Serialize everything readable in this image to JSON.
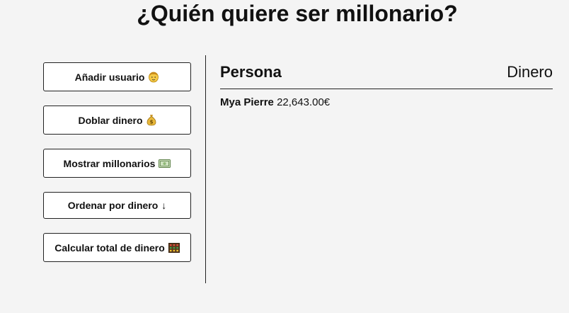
{
  "title": "¿Quién quiere ser millonario?",
  "buttons": {
    "add_user": {
      "label": "Añadir usuario",
      "icon": "person-face-icon"
    },
    "double_money": {
      "label": "Doblar dinero",
      "icon": "money-bag-icon"
    },
    "show_millionaires": {
      "label": "Mostrar millonarios",
      "icon": "banknote-icon"
    },
    "sort_money": {
      "label": "Ordenar por dinero",
      "arrow": "↓"
    },
    "total_money": {
      "label": "Calcular total de dinero",
      "icon": "abacus-icon"
    }
  },
  "main": {
    "header_person": "Persona",
    "header_money": "Dinero",
    "people": [
      {
        "name": "Mya Pierre",
        "money": "22,643.00€"
      }
    ]
  },
  "colors": {
    "background": "#f4f4f4",
    "button_bg": "#ffffff",
    "border": "#222222"
  }
}
